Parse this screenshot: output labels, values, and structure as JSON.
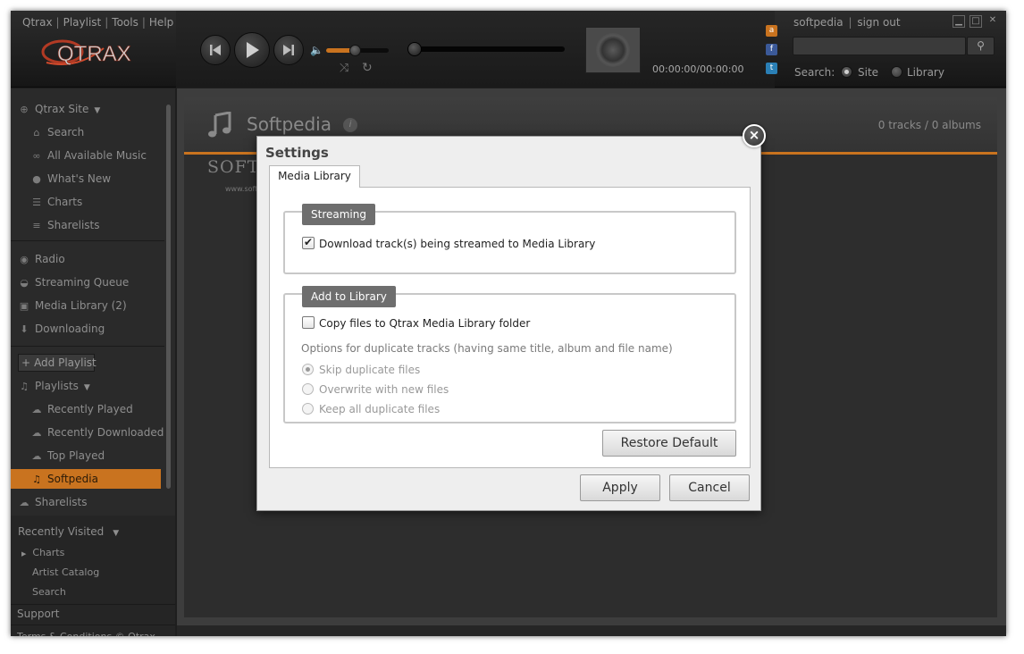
{
  "menu": {
    "items": [
      "Qtrax",
      "Playlist",
      "Tools",
      "Help"
    ],
    "separator": "|"
  },
  "brand": {
    "logo_text": "QTRAX"
  },
  "player": {
    "time": "00:00:00/00:00:00",
    "volume_level": 0.45,
    "seek_position": 0.0
  },
  "social": [
    {
      "name": "lastfm-icon",
      "glyph": "a",
      "color": "#c9731f"
    },
    {
      "name": "facebook-icon",
      "glyph": "f",
      "color": "#3b5998"
    },
    {
      "name": "twitter-icon",
      "glyph": "t",
      "color": "#2a7fb5"
    }
  ],
  "user": {
    "username": "softpedia",
    "separator": "|",
    "sign_out": "sign out"
  },
  "search": {
    "value": "",
    "label": "Search:",
    "options": [
      "Site",
      "Library"
    ],
    "selected": "Site"
  },
  "sidebar": {
    "site_header": "Qtrax Site",
    "site_items": [
      "Search",
      "All Available Music",
      "What's New",
      "Charts",
      "Sharelists"
    ],
    "main_items": [
      "Radio",
      "Streaming Queue",
      "Media Library (2)",
      "Downloading"
    ],
    "add_playlist": "Add Playlist",
    "playlists_header": "Playlists",
    "playlist_items": [
      "Recently Played",
      "Recently Downloaded",
      "Top Played",
      "Softpedia"
    ],
    "active_playlist": "Softpedia",
    "sharelists": "Sharelists",
    "recently_visited_header": "Recently Visited",
    "recent_items": [
      "Charts",
      "Artist Catalog",
      "Search"
    ],
    "support": "Support",
    "terms": "Terms & Conditions © Qtrax"
  },
  "page": {
    "title": "Softpedia",
    "info_glyph": "i",
    "counts": "0 tracks / 0 albums",
    "watermark": "SOFTPEDIA",
    "watermark_url": "www.softpedia.com"
  },
  "dialog": {
    "title": "Settings",
    "close_glyph": "×",
    "tab": "Media Library",
    "streaming": {
      "legend": "Streaming",
      "download_label": "Download track(s) being streamed to Media Library",
      "download_checked": true
    },
    "add_to_library": {
      "legend": "Add to Library",
      "copy_label": "Copy files to Qtrax Media Library folder",
      "copy_checked": false,
      "duplicate_desc": "Options for duplicate tracks (having same title, album and file name)",
      "duplicate_options": [
        "Skip duplicate files",
        "Overwrite with new files",
        "Keep all duplicate files"
      ],
      "duplicate_selected": "Skip duplicate files"
    },
    "restore_default": "Restore Default",
    "apply": "Apply",
    "cancel": "Cancel"
  },
  "colors": {
    "accent": "#c9731f",
    "window_bg": "#1e1e1e",
    "dialog_bg": "#eeeeee"
  }
}
